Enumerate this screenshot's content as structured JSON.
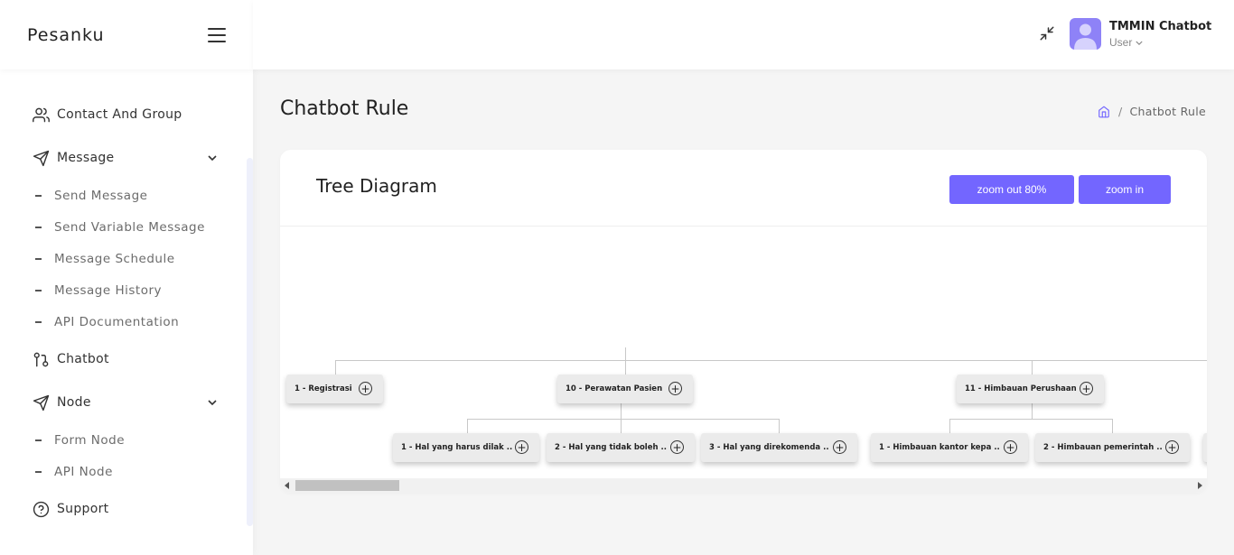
{
  "app": {
    "brand": "Pesanku"
  },
  "user": {
    "name": "TMMIN Chatbot",
    "role": "User"
  },
  "sidebar": {
    "items": [
      {
        "label": "Contact And Group",
        "icon": "users-icon"
      },
      {
        "label": "Message",
        "icon": "send-icon",
        "expanded": true,
        "children": [
          "Send Message",
          "Send Variable Message",
          "Message Schedule",
          "Message History",
          "API Documentation"
        ]
      },
      {
        "label": "Chatbot",
        "icon": "git-pull-request-icon"
      },
      {
        "label": "Node",
        "icon": "send-icon",
        "expanded": true,
        "children": [
          "Form Node",
          "API Node"
        ]
      },
      {
        "label": "Support",
        "icon": "help-circle-icon"
      }
    ]
  },
  "page": {
    "title": "Chatbot Rule",
    "breadcrumb": [
      "home-icon",
      "Chatbot Rule"
    ]
  },
  "card": {
    "title": "Tree Diagram",
    "zoom_out_label": "zoom out 80%",
    "zoom_in_label": "zoom in"
  },
  "tree": {
    "level1": [
      {
        "label": "1 - Registrasi"
      },
      {
        "label": "10 - Perawatan Pasien"
      },
      {
        "label": "11 - Himbauan Perushaan"
      }
    ],
    "level2": [
      {
        "label": "1 - Hal yang harus dilak ..",
        "parent": "10 - Perawatan Pasien"
      },
      {
        "label": "2 - Hal yang tidak boleh ..",
        "parent": "10 - Perawatan Pasien"
      },
      {
        "label": "3 - Hal yang direkomenda ..",
        "parent": "10 - Perawatan Pasien"
      },
      {
        "label": "1 - Himbauan kantor kepa ..",
        "parent": "11 - Himbauan Perushaan"
      },
      {
        "label": "2 - Himbauan pemerintah ..",
        "parent": "11 - Himbauan Perushaan"
      }
    ]
  },
  "colors": {
    "accent": "#7366ff",
    "avatar": "#8e82f7"
  }
}
